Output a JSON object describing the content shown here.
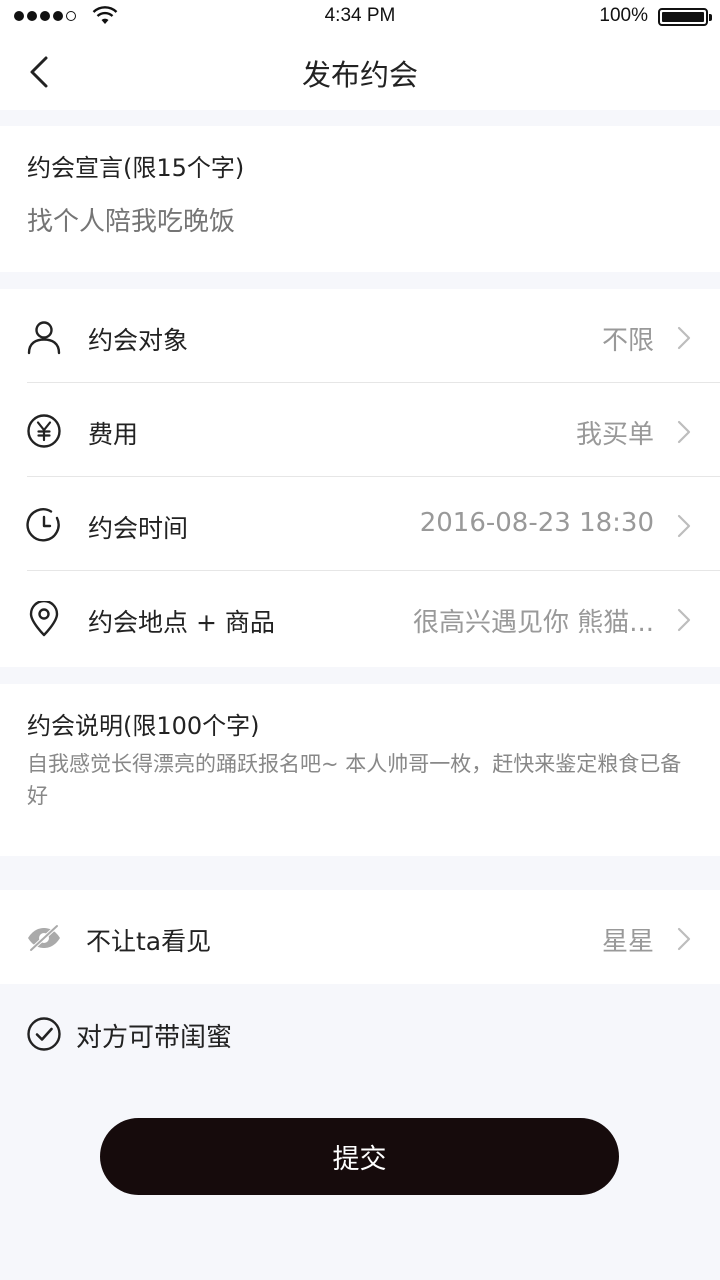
{
  "status_bar": {
    "time": "4:34 PM",
    "battery_percent": "100%"
  },
  "nav": {
    "title": "发布约会",
    "back_icon": "chevron-left-icon"
  },
  "manifesto": {
    "label": "约会宣言(限15个字)",
    "placeholder": "找个人陪我吃晚饭"
  },
  "settings": {
    "rows": [
      {
        "icon": "person-icon",
        "label": "约会对象",
        "value": "不限"
      },
      {
        "icon": "yuan-icon",
        "label": "费用",
        "value": "我买单"
      },
      {
        "icon": "clock-icon",
        "label": "约会时间",
        "value": "2016-08-23  18:30"
      },
      {
        "icon": "location-pin-icon",
        "label": "约会地点 + 商品",
        "value": "很高兴遇见你  熊猫..."
      }
    ]
  },
  "description": {
    "label": "约会说明(限100个字)",
    "text": "自我感觉长得漂亮的踊跃报名吧~ 本人帅哥一枚，赶快来鉴定粮食已备好"
  },
  "hide_from": {
    "icon": "eye-slash-icon",
    "label": "不让ta看见",
    "value": "星星"
  },
  "bestie_option": {
    "icon": "check-circle-icon",
    "label": "对方可带闺蜜",
    "checked": true
  },
  "submit": {
    "label": "提交"
  },
  "colors": {
    "background": "#f6f7fb",
    "button": "#160b0c",
    "muted_text": "#999999"
  }
}
